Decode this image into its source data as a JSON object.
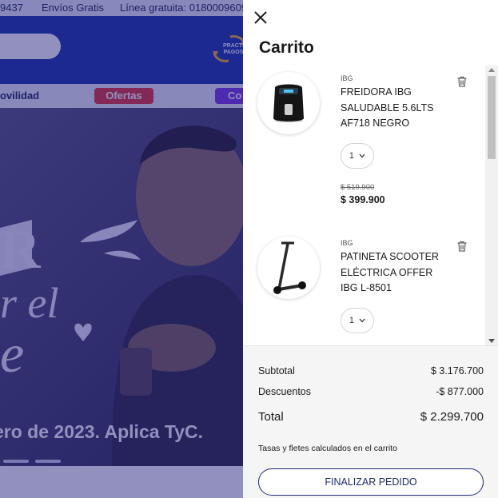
{
  "background": {
    "topbar": {
      "phone": "9437",
      "shipping": "Envíos Gratis",
      "hotline": "Línea gratuita: 0180009609"
    },
    "header": {
      "logo_text": "PRACTI PAGOS"
    },
    "nav": {
      "item_partial": "ovilidad",
      "ofertas": "Ofertas",
      "next_partial": "Co"
    },
    "hero": {
      "headline_fragment": "ero de 2023. Aplica TyC."
    }
  },
  "cart": {
    "title": "Carrito",
    "items": [
      {
        "brand": "IBG",
        "name": "FREIDORA IBG SALUDABLE 5.6LTS AF718 NEGRO",
        "quantity": "1",
        "old_price": "$ 519.900",
        "price": "$ 399.900",
        "icon": "air-fryer-image"
      },
      {
        "brand": "IBG",
        "name": "PATINETA SCOOTER ELÉCTRICA OFFER IBG L-8501",
        "quantity": "1",
        "icon": "scooter-image"
      }
    ],
    "summary": {
      "subtotal_label": "Subtotal",
      "subtotal_value": "$ 3.176.700",
      "discount_label": "Descuentos",
      "discount_value": "-$ 877.000",
      "total_label": "Total",
      "total_value": "$ 2.299.700",
      "note": "Tasas y fletes calculados en el carrito",
      "checkout_label": "FINALIZAR PEDIDO"
    }
  },
  "colors": {
    "header_blue": "#1c3aa8",
    "ofertas_pill": "#e23a3a",
    "checkout_border": "#1d2c6e",
    "overlay": "rgba(28,22,120,0.48)"
  }
}
